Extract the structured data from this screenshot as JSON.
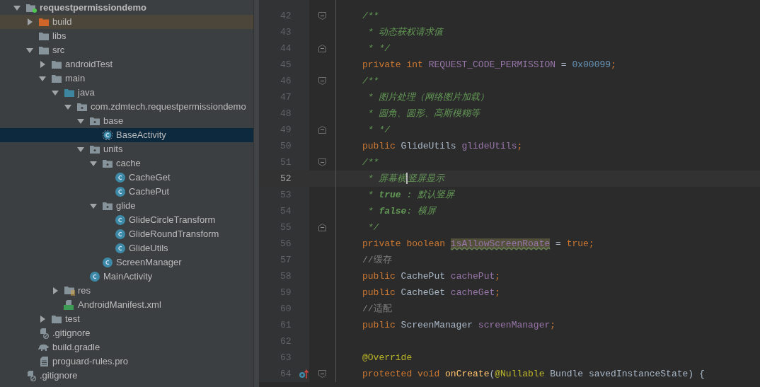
{
  "project_tree": [
    {
      "label": "requestpermissiondemo",
      "kind": "module",
      "expanded": true,
      "selected": false,
      "children": [
        {
          "label": "build",
          "kind": "excluded-folder",
          "expanded": false,
          "selected": false,
          "highlighted": true
        },
        {
          "label": "libs",
          "kind": "folder",
          "selected": false
        },
        {
          "label": "src",
          "kind": "folder",
          "expanded": true,
          "selected": false,
          "children": [
            {
              "label": "androidTest",
              "kind": "folder",
              "expanded": false,
              "selected": false
            },
            {
              "label": "main",
              "kind": "folder",
              "expanded": true,
              "selected": false,
              "children": [
                {
                  "label": "java",
                  "kind": "source-folder",
                  "expanded": true,
                  "selected": false,
                  "children": [
                    {
                      "label": "com.zdmtech.requestpermissiondemo",
                      "kind": "package",
                      "expanded": true,
                      "selected": false,
                      "children": [
                        {
                          "label": "base",
                          "kind": "package",
                          "expanded": true,
                          "selected": false,
                          "children": [
                            {
                              "label": "BaseActivity",
                              "kind": "abstract-class",
                              "selected": true
                            }
                          ]
                        },
                        {
                          "label": "units",
                          "kind": "package",
                          "expanded": true,
                          "selected": false,
                          "children": [
                            {
                              "label": "cache",
                              "kind": "package",
                              "expanded": true,
                              "selected": false,
                              "children": [
                                {
                                  "label": "CacheGet",
                                  "kind": "class",
                                  "selected": false
                                },
                                {
                                  "label": "CachePut",
                                  "kind": "class",
                                  "selected": false
                                }
                              ]
                            },
                            {
                              "label": "glide",
                              "kind": "package",
                              "expanded": true,
                              "selected": false,
                              "children": [
                                {
                                  "label": "GlideCircleTransform",
                                  "kind": "class",
                                  "selected": false
                                },
                                {
                                  "label": "GlideRoundTransform",
                                  "kind": "class",
                                  "selected": false
                                },
                                {
                                  "label": "GlideUtils",
                                  "kind": "class",
                                  "selected": false
                                }
                              ]
                            },
                            {
                              "label": "ScreenManager",
                              "kind": "class",
                              "selected": false
                            }
                          ]
                        },
                        {
                          "label": "MainActivity",
                          "kind": "class",
                          "selected": false
                        }
                      ]
                    }
                  ]
                },
                {
                  "label": "res",
                  "kind": "res-folder",
                  "expanded": false,
                  "selected": false
                },
                {
                  "label": "AndroidManifest.xml",
                  "kind": "manifest",
                  "selected": false
                }
              ]
            },
            {
              "label": "test",
              "kind": "folder",
              "expanded": false,
              "selected": false
            }
          ]
        },
        {
          "label": ".gitignore",
          "kind": "ignore-file",
          "selected": false
        },
        {
          "label": "build.gradle",
          "kind": "gradle-file",
          "selected": false
        },
        {
          "label": "proguard-rules.pro",
          "kind": "text-file",
          "selected": false
        }
      ]
    },
    {
      "label": ".gitignore",
      "kind": "ignore-file",
      "selected": false
    }
  ],
  "editor": {
    "lines": [
      {
        "number": "42",
        "fold_start": true,
        "current": false,
        "tokens": [
          {
            "kind": "doc",
            "text": "/**"
          }
        ]
      },
      {
        "number": "43",
        "current": false,
        "tokens": [
          {
            "kind": "doc",
            "text": " * 动态获权请求值"
          }
        ]
      },
      {
        "number": "44",
        "fold_end": true,
        "current": false,
        "tokens": [
          {
            "kind": "doc",
            "text": " * */"
          }
        ]
      },
      {
        "number": "45",
        "current": false,
        "tokens": [
          {
            "kind": "keyword",
            "text": "private int "
          },
          {
            "kind": "field",
            "text": "REQUEST_CODE_PERMISSION"
          },
          {
            "kind": "plain",
            "text": " = "
          },
          {
            "kind": "number",
            "text": "0x00099"
          },
          {
            "kind": "keyword",
            "text": ";"
          }
        ]
      },
      {
        "number": "46",
        "fold_start": true,
        "current": false,
        "tokens": [
          {
            "kind": "doc",
            "text": "/**"
          }
        ]
      },
      {
        "number": "47",
        "current": false,
        "tokens": [
          {
            "kind": "doc",
            "text": " * 图片处理（网络图片加载）"
          }
        ]
      },
      {
        "number": "48",
        "current": false,
        "tokens": [
          {
            "kind": "doc",
            "text": " * 圆角、圆形、高斯模糊等"
          }
        ]
      },
      {
        "number": "49",
        "fold_end": true,
        "current": false,
        "tokens": [
          {
            "kind": "doc",
            "text": " * */"
          }
        ]
      },
      {
        "number": "50",
        "current": false,
        "tokens": [
          {
            "kind": "keyword",
            "text": "public "
          },
          {
            "kind": "plain",
            "text": "GlideUtils "
          },
          {
            "kind": "field",
            "text": "glideUtils"
          },
          {
            "kind": "keyword",
            "text": ";"
          }
        ]
      },
      {
        "number": "51",
        "fold_start": true,
        "current": false,
        "tokens": [
          {
            "kind": "doc",
            "text": "/**"
          }
        ]
      },
      {
        "number": "52",
        "current": true,
        "tokens": [
          {
            "kind": "doc",
            "text": " * 屏幕横"
          },
          {
            "kind": "caret"
          },
          {
            "kind": "doc",
            "text": "竖屏显示"
          }
        ]
      },
      {
        "number": "53",
        "current": false,
        "tokens": [
          {
            "kind": "doc",
            "text": " * "
          },
          {
            "kind": "doc-bold",
            "text": "true"
          },
          {
            "kind": "doc",
            "text": " : 默认竖屏"
          }
        ]
      },
      {
        "number": "54",
        "current": false,
        "tokens": [
          {
            "kind": "doc",
            "text": " * "
          },
          {
            "kind": "doc-bold",
            "text": "false"
          },
          {
            "kind": "doc",
            "text": ": 横屏"
          }
        ]
      },
      {
        "number": "55",
        "fold_end": true,
        "current": false,
        "tokens": [
          {
            "kind": "doc",
            "text": " */"
          }
        ]
      },
      {
        "number": "56",
        "current": false,
        "tokens": [
          {
            "kind": "keyword",
            "text": "private boolean "
          },
          {
            "kind": "field-marked",
            "text": "isAllowScreenRoate"
          },
          {
            "kind": "plain",
            "text": " = "
          },
          {
            "kind": "keyword",
            "text": "true;"
          }
        ]
      },
      {
        "number": "57",
        "current": false,
        "tokens": [
          {
            "kind": "comment",
            "text": "//缓存"
          }
        ]
      },
      {
        "number": "58",
        "current": false,
        "tokens": [
          {
            "kind": "keyword",
            "text": "public "
          },
          {
            "kind": "plain",
            "text": "CachePut "
          },
          {
            "kind": "field",
            "text": "cachePut"
          },
          {
            "kind": "keyword",
            "text": ";"
          }
        ]
      },
      {
        "number": "59",
        "current": false,
        "tokens": [
          {
            "kind": "keyword",
            "text": "public "
          },
          {
            "kind": "plain",
            "text": "CacheGet "
          },
          {
            "kind": "field",
            "text": "cacheGet"
          },
          {
            "kind": "keyword",
            "text": ";"
          }
        ]
      },
      {
        "number": "60",
        "current": false,
        "tokens": [
          {
            "kind": "comment",
            "text": "//适配"
          }
        ]
      },
      {
        "number": "61",
        "current": false,
        "tokens": [
          {
            "kind": "keyword",
            "text": "public "
          },
          {
            "kind": "plain",
            "text": "ScreenManager "
          },
          {
            "kind": "field",
            "text": "screenManager"
          },
          {
            "kind": "keyword",
            "text": ";"
          }
        ]
      },
      {
        "number": "62",
        "current": false
      },
      {
        "number": "63",
        "current": false,
        "tokens": [
          {
            "kind": "annotation",
            "text": "@Override"
          }
        ]
      },
      {
        "number": "64",
        "fold_start": true,
        "override_marker": true,
        "current": false,
        "tokens": [
          {
            "kind": "keyword",
            "text": "protected void "
          },
          {
            "kind": "method",
            "text": "onCreate"
          },
          {
            "kind": "plain",
            "text": "("
          },
          {
            "kind": "annotation",
            "text": "@Nullable"
          },
          {
            "kind": "plain",
            "text": " Bundle savedInstanceState) {"
          }
        ]
      }
    ]
  }
}
